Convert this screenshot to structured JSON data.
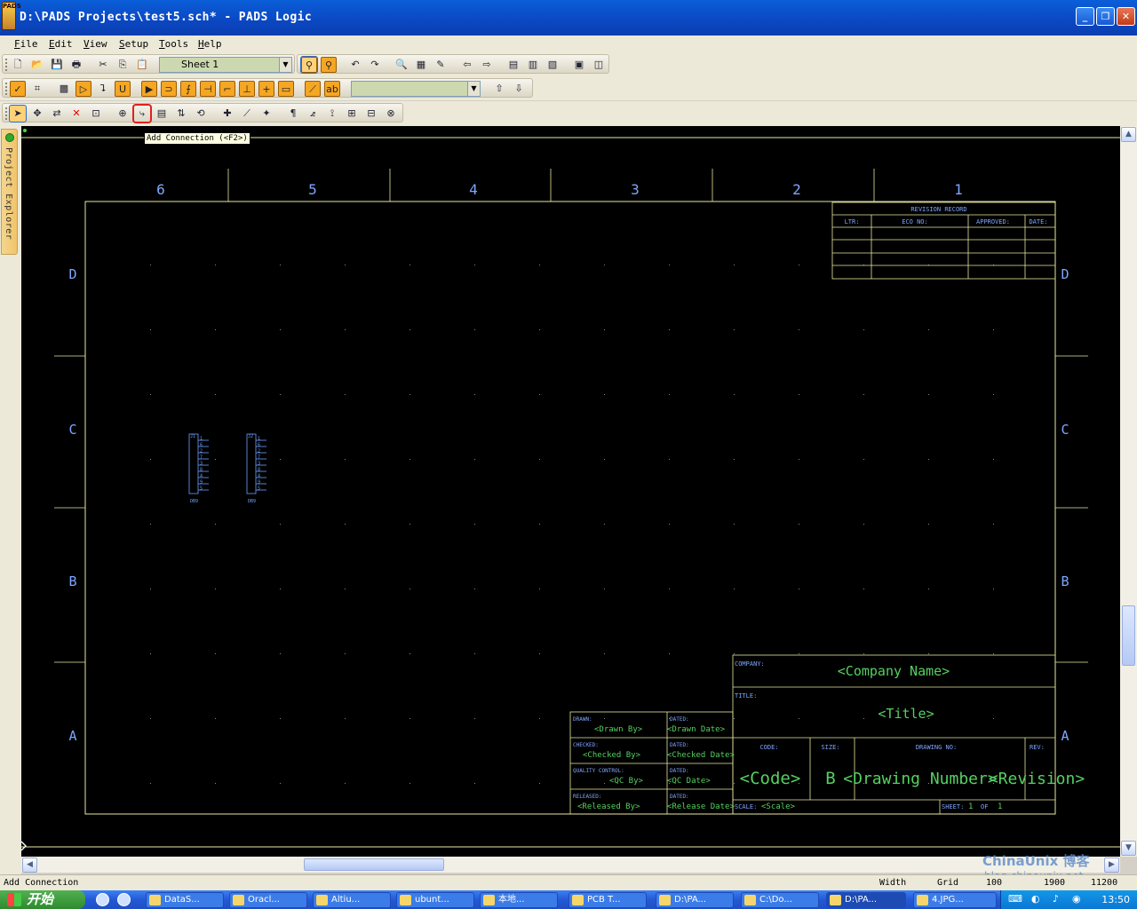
{
  "window": {
    "title": "D:\\PADS Projects\\test5.sch* - PADS Logic",
    "app_icon_text": "PADS"
  },
  "menu": [
    {
      "label": "File"
    },
    {
      "label": "Edit"
    },
    {
      "label": "View"
    },
    {
      "label": "Setup"
    },
    {
      "label": "Tools"
    },
    {
      "label": "Help"
    }
  ],
  "toolbar": {
    "sheet_selector": "Sheet 1",
    "text_combo": ""
  },
  "tooltip": "Add Connection (<F2>)",
  "project_explorer": {
    "label": "Project Explorer"
  },
  "schematic": {
    "zone_numbers": [
      "6",
      "5",
      "4",
      "3",
      "2",
      "1"
    ],
    "zone_letters": [
      "D",
      "C",
      "B",
      "A"
    ],
    "revision_record": {
      "title": "REVISION RECORD",
      "headers": [
        "LTR:",
        "ECO NO:",
        "APPROVED:",
        "DATE:"
      ]
    },
    "title_block": {
      "company_label": "COMPANY:",
      "company": "<Company Name>",
      "title_label": "TITLE:",
      "title": "<Title>",
      "code_label": "CODE:",
      "code": "<Code>",
      "size_label": "SIZE:",
      "size": "B",
      "drawing_no_label": "DRAWING NO:",
      "drawing_no": "<Drawing Number>",
      "rev_label": "REV:",
      "rev": "<Revision>",
      "scale_label": "SCALE:",
      "scale": "<Scale>",
      "sheet_label": "SHEET:",
      "sheet_num": "1",
      "of_label": "OF",
      "sheet_total": "1",
      "drawn_label": "DRAWN:",
      "drawn": "<Drawn By>",
      "drawn_dated_label": "DATED:",
      "drawn_date": "<Drawn Date>",
      "checked_label": "CHECKED:",
      "checked": "<Checked By>",
      "checked_dated_label": "DATED:",
      "checked_date": "<Checked Date>",
      "qc_label": "QUALITY CONTROL:",
      "qc": "<QC By>",
      "qc_dated_label": "DATED:",
      "qc_date": "<QC Date>",
      "released_label": "RELEASED:",
      "released": "<Released By>",
      "released_dated_label": "DATED:",
      "released_date": "<Release Date>"
    },
    "parts": [
      {
        "ref": "J1",
        "name": "DB9",
        "pins": [
          "1",
          "6",
          "2",
          "7",
          "3",
          "8",
          "4",
          "9",
          "5"
        ]
      },
      {
        "ref": "J2",
        "name": "DB9",
        "pins": [
          "1",
          "6",
          "2",
          "7",
          "3",
          "8",
          "4",
          "9",
          "5"
        ]
      }
    ]
  },
  "status": {
    "message": "Add Connection",
    "width_label": "Width",
    "grid_label": "Grid",
    "width_value": "100",
    "x": "1900",
    "y": "11200"
  },
  "watermark": {
    "brand": "ChinaUnix 博客",
    "url": "blog.chinaunix.net",
    "tag": ".net"
  },
  "taskbar": {
    "start": "开始",
    "buttons": [
      {
        "label": "DataS..."
      },
      {
        "label": "Oracl..."
      },
      {
        "label": "Altiu..."
      },
      {
        "label": "ubunt..."
      },
      {
        "label": "本地..."
      },
      {
        "label": "PCB T..."
      },
      {
        "label": "D:\\PA..."
      },
      {
        "label": "C:\\Do..."
      },
      {
        "label": "D:\\PA..."
      },
      {
        "label": "4.JPG..."
      }
    ],
    "clock": "13:50"
  },
  "colors": {
    "canvas_bg": "#000000",
    "sheet_line": "#e8e8a0",
    "label_blue": "#7fa6ff",
    "title_green": "#55d060",
    "part_cyan": "#6ea2ff"
  }
}
